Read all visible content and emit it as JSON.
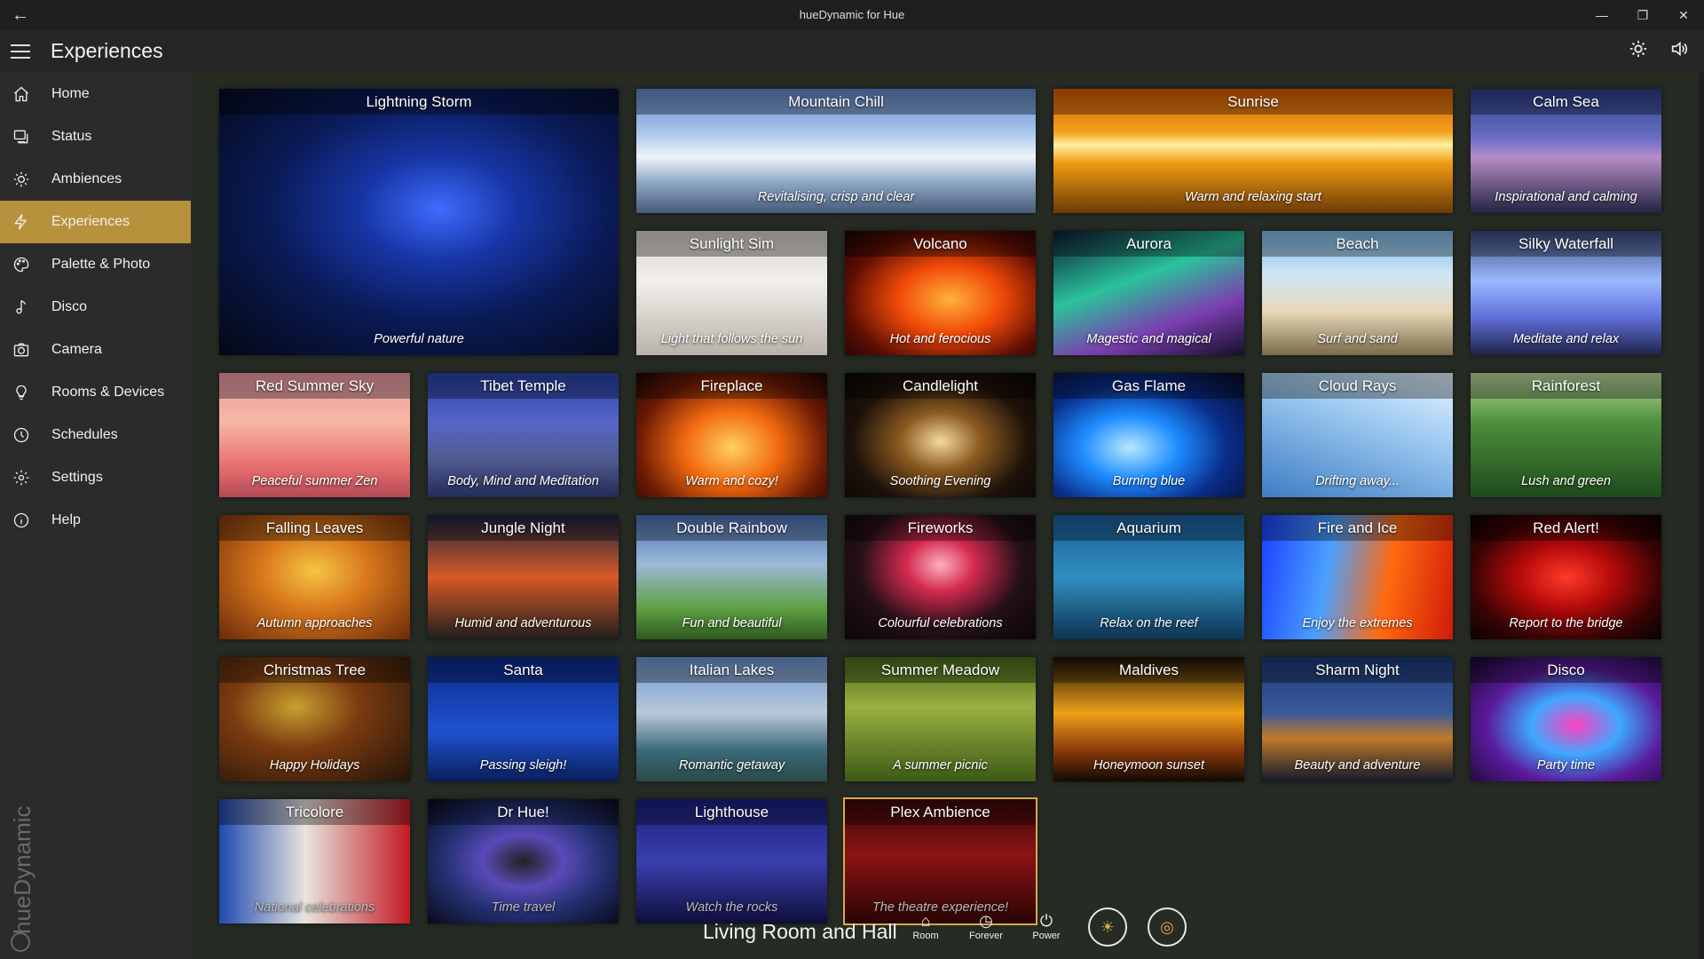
{
  "app": {
    "title": "hueDynamic for Hue",
    "back": "←",
    "minimize": "—",
    "restore": "❐",
    "close": "✕"
  },
  "header": {
    "title": "Experiences",
    "brightness_icon": "brightness-icon",
    "sound_icon": "speaker-icon"
  },
  "sidebar": {
    "items": [
      {
        "label": "Home",
        "icon": "home-icon"
      },
      {
        "label": "Status",
        "icon": "status-icon"
      },
      {
        "label": "Ambiences",
        "icon": "sun-icon"
      },
      {
        "label": "Experiences",
        "icon": "lightning-icon",
        "active": true
      },
      {
        "label": "Palette & Photo",
        "icon": "palette-icon"
      },
      {
        "label": "Disco",
        "icon": "music-note-icon"
      },
      {
        "label": "Camera",
        "icon": "camera-icon"
      },
      {
        "label": "Rooms & Devices",
        "icon": "bulb-icon"
      },
      {
        "label": "Schedules",
        "icon": "clock-icon"
      },
      {
        "label": "Settings",
        "icon": "gear-icon"
      },
      {
        "label": "Help",
        "icon": "info-icon"
      }
    ],
    "brand": "hueDynamic"
  },
  "tiles": [
    {
      "title": "Lightning Storm",
      "subtitle": "Powerful nature"
    },
    {
      "title": "Mountain Chill",
      "subtitle": "Revitalising, crisp and clear"
    },
    {
      "title": "Sunrise",
      "subtitle": "Warm and relaxing start"
    },
    {
      "title": "Calm Sea",
      "subtitle": "Inspirational and calming"
    },
    {
      "title": "Sunlight Sim",
      "subtitle": "Light that follows the sun"
    },
    {
      "title": "Volcano",
      "subtitle": "Hot and ferocious"
    },
    {
      "title": "Aurora",
      "subtitle": "Magestic and magical"
    },
    {
      "title": "Beach",
      "subtitle": "Surf and sand"
    },
    {
      "title": "Silky Waterfall",
      "subtitle": "Meditate and relax"
    },
    {
      "title": "Red Summer Sky",
      "subtitle": "Peaceful summer Zen"
    },
    {
      "title": "Tibet Temple",
      "subtitle": "Body, Mind and Meditation"
    },
    {
      "title": "Fireplace",
      "subtitle": "Warm and cozy!"
    },
    {
      "title": "Candlelight",
      "subtitle": "Soothing Evening"
    },
    {
      "title": "Gas Flame",
      "subtitle": "Burning blue"
    },
    {
      "title": "Cloud Rays",
      "subtitle": "Drifting away..."
    },
    {
      "title": "Rainforest",
      "subtitle": "Lush and green"
    },
    {
      "title": "Falling Leaves",
      "subtitle": "Autumn approaches"
    },
    {
      "title": "Jungle Night",
      "subtitle": "Humid and adventurous"
    },
    {
      "title": "Double Rainbow",
      "subtitle": "Fun and beautiful"
    },
    {
      "title": "Fireworks",
      "subtitle": "Colourful celebrations"
    },
    {
      "title": "Aquarium",
      "subtitle": "Relax on the reef"
    },
    {
      "title": "Fire and Ice",
      "subtitle": "Enjoy the extremes"
    },
    {
      "title": "Red Alert!",
      "subtitle": "Report to the bridge"
    },
    {
      "title": "Christmas Tree",
      "subtitle": "Happy Holidays"
    },
    {
      "title": "Santa",
      "subtitle": "Passing sleigh!"
    },
    {
      "title": "Italian Lakes",
      "subtitle": "Romantic getaway"
    },
    {
      "title": "Summer Meadow",
      "subtitle": "A summer picnic"
    },
    {
      "title": "Maldives",
      "subtitle": "Honeymoon sunset"
    },
    {
      "title": "Sharm Night",
      "subtitle": "Beauty and adventure"
    },
    {
      "title": "Disco",
      "subtitle": "Party time"
    },
    {
      "title": "Tricolore",
      "subtitle": "National celebrations"
    },
    {
      "title": "Dr Hue!",
      "subtitle": "Time travel"
    },
    {
      "title": "Lighthouse",
      "subtitle": "Watch the rocks"
    },
    {
      "title": "Plex Ambience",
      "subtitle": "The theatre experience!"
    }
  ],
  "bottom_bar": {
    "room": "Living Room and Hall",
    "room_btn": "Room",
    "forever_btn": "Forever",
    "power_btn": "Power"
  },
  "colors": {
    "accent": "#b8913c",
    "sidebar_bg": "#2b2b2b",
    "titlebar_bg": "#1f1f1f"
  }
}
